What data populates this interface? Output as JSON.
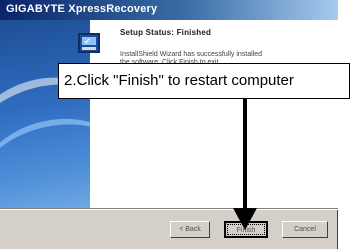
{
  "window": {
    "title": "GIGABYTE XpressRecovery"
  },
  "wizard": {
    "heading": "Setup Status: Finished",
    "description": "InstallShield Wizard has successfully installed the software. Click Finish to exit."
  },
  "buttons": {
    "back_label": "< Back",
    "finish_label": "Finish",
    "cancel_label": "Cancel"
  },
  "callout": {
    "text": "2.Click \"Finish\" to restart computer"
  },
  "colors": {
    "title_bar": "#0a246a",
    "panel_blue": "#2f6cc0",
    "dialog_face": "#d4d0c8"
  },
  "icons": {
    "setup_icon": "computer-setup-icon",
    "pointer_arrow": "down-arrow-icon"
  }
}
